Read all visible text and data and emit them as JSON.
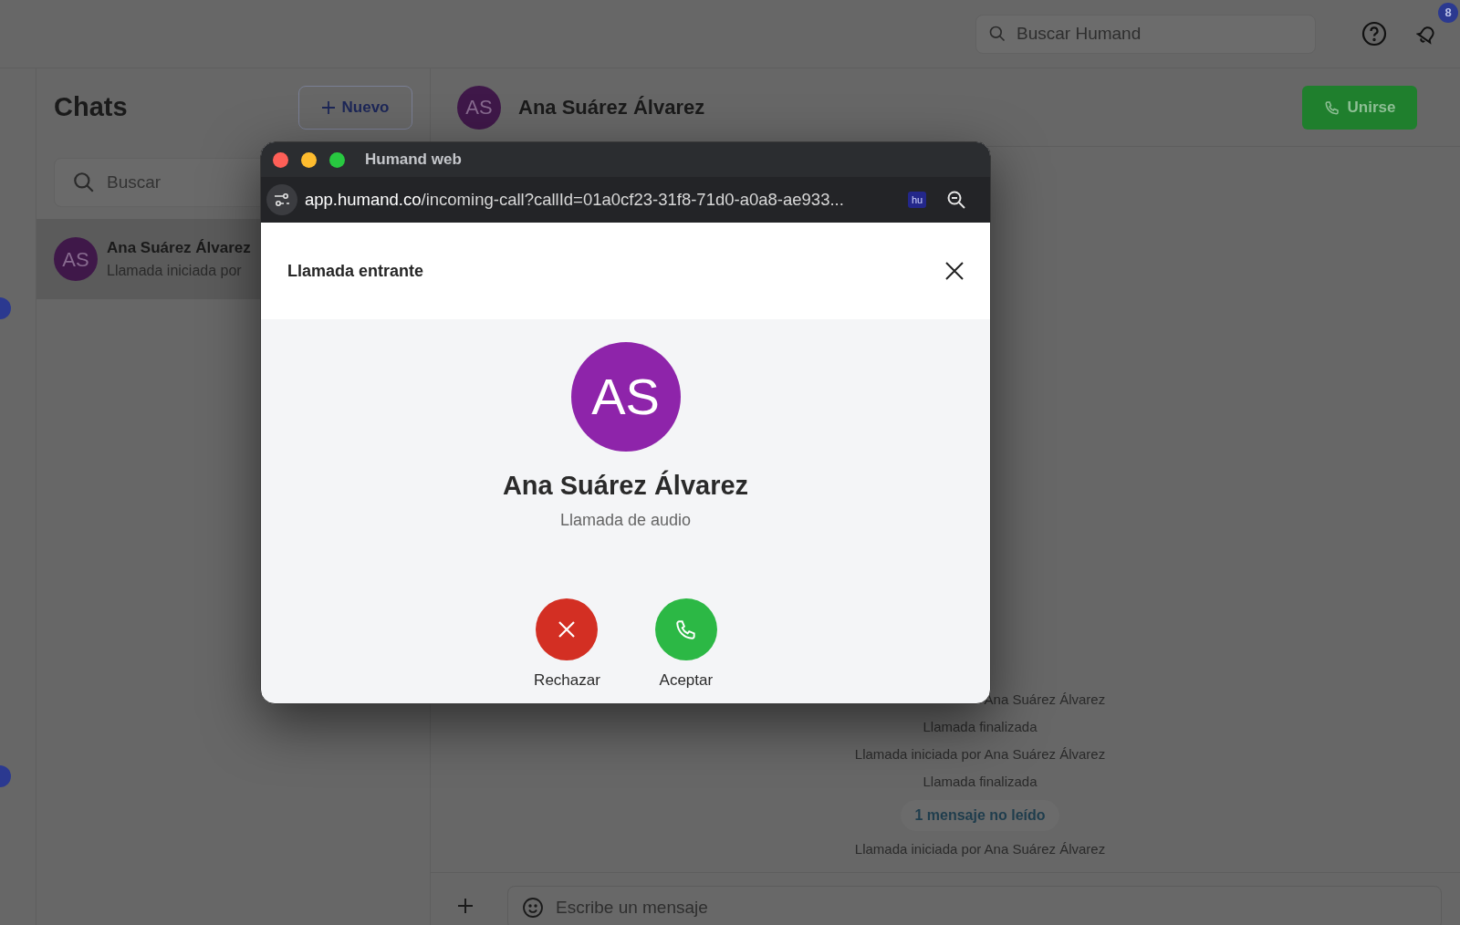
{
  "topbar": {
    "search": {
      "placeholder": "Buscar Humand"
    },
    "notifications_badge": "8"
  },
  "chats_panel": {
    "title": "Chats",
    "new_button": "Nuevo",
    "search": {
      "placeholder": "Buscar"
    },
    "items": [
      {
        "initials": "AS",
        "name": "Ana Suárez Álvarez",
        "preview": "Llamada iniciada por",
        "selected": true
      }
    ]
  },
  "chat": {
    "initials": "AS",
    "name": "Ana Suárez Álvarez",
    "join_button": "Unirse",
    "messages": [
      {
        "kind": "partial",
        "text": "Ana Suárez Álvarez"
      },
      {
        "kind": "event",
        "text": "Llamada finalizada"
      },
      {
        "kind": "event",
        "text": "Llamada iniciada por Ana Suárez Álvarez"
      },
      {
        "kind": "event",
        "text": "Llamada finalizada"
      },
      {
        "kind": "unread",
        "text": "1 mensaje no leído"
      },
      {
        "kind": "event",
        "text": "Llamada iniciada por Ana Suárez Álvarez"
      }
    ],
    "composer": {
      "placeholder": "Escribe un mensaje"
    }
  },
  "popup": {
    "title": "Humand web",
    "url_host": "app.humand.co",
    "url_path": "/incoming-call?callId=01a0cf23-31f8-71d0-a0a8-ae933...",
    "extension_badge": "hu",
    "header": "Llamada entrante",
    "caller": {
      "initials": "AS",
      "name": "Ana Suárez Álvarez",
      "call_type": "Llamada de audio"
    },
    "actions": [
      {
        "kind": "decline",
        "label": "Rechazar"
      },
      {
        "kind": "accept",
        "label": "Aceptar"
      }
    ]
  }
}
